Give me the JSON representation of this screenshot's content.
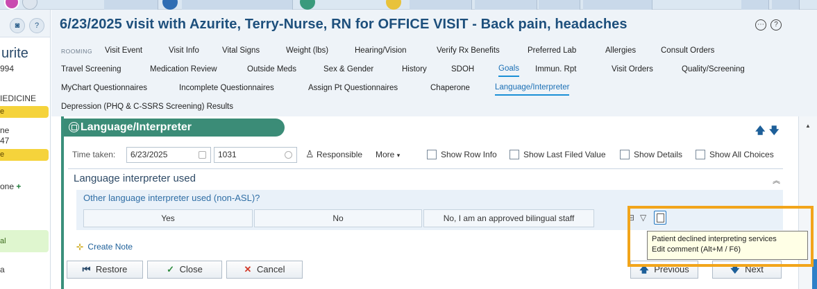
{
  "header": {
    "visit_title": "6/23/2025 visit with Azurite, Terry-Nurse, RN for OFFICE VISIT - Back pain, headaches"
  },
  "sidebar": {
    "patient_name_fragment": "urite",
    "id_fragment": "994",
    "dept_fragment": "IEDICINE",
    "badge1": "e",
    "text1": "ne",
    "text2": "47",
    "badge2": "e",
    "add_fragment": "one",
    "add_symbol": "+",
    "green_fragment": "al",
    "text3": "a"
  },
  "navigator": {
    "rooming_label": "ROOMING",
    "row1": [
      "Visit Event",
      "Visit Info",
      "Vital Signs",
      "Weight (lbs)",
      "Hearing/Vision",
      "Verify Rx Benefits",
      "Preferred Lab",
      "Allergies",
      "Consult Orders"
    ],
    "row2": [
      "Travel Screening",
      "Medication Review",
      "Outside Meds",
      "Sex & Gender",
      "History",
      "SDOH",
      "Goals",
      "Immun. Rpt",
      "Visit Orders",
      "Quality/Screening"
    ],
    "row3": [
      "MyChart Questionnaires",
      "Incomplete Questionnaires",
      "Assign Pt Questionnaires",
      "Chaperone",
      "Language/Interpreter"
    ],
    "row4": [
      "Depression (PHQ & C-SSRS Screening) Results"
    ]
  },
  "section": {
    "title": "Language/Interpreter",
    "time_taken_label": "Time taken:",
    "date_value": "6/23/2025",
    "time_value": "1031",
    "responsible_label": "Responsible",
    "more_label": "More",
    "more_caret": "▾",
    "checkboxes": [
      "Show Row Info",
      "Show Last Filed Value",
      "Show Details",
      "Show All Choices"
    ],
    "group_title": "Language interpreter used",
    "question": "Other language interpreter used (non-ASL)?",
    "choices": [
      "Yes",
      "No",
      "No, I am an approved bilingual staff"
    ],
    "create_note": "Create Note",
    "buttons": {
      "restore": "Restore",
      "close": "Close",
      "cancel": "Cancel",
      "previous": "Previous",
      "next": "Next"
    }
  },
  "tooltip": {
    "line1": "Patient declined interpreting services",
    "line2": "Edit comment (Alt+M / F6)"
  },
  "colors": {
    "accent": "#3b8c77",
    "title_blue": "#1d4f7c",
    "highlight": "#f2a51b"
  }
}
